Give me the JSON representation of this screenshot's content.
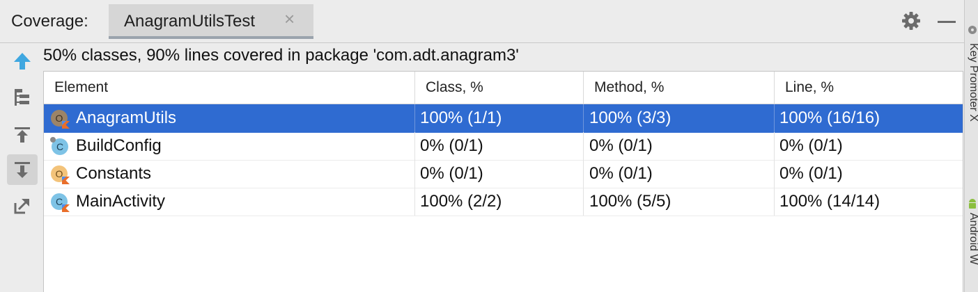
{
  "toolwindow": {
    "label": "Coverage:",
    "tab_title": "AnagramUtilsTest",
    "close_glyph": "×"
  },
  "toolbar_icons": [
    "up-arrow-icon",
    "flatten-packages-icon",
    "import-coverage-icon",
    "export-coverage-icon",
    "open-external-icon"
  ],
  "summary": "50% classes, 90% lines covered in package 'com.adt.anagram3'",
  "table": {
    "columns": [
      "Element",
      "Class, %",
      "Method, %",
      "Line, %"
    ],
    "rows": [
      {
        "name": "AnagramUtils",
        "class_pct": "100% (1/1)",
        "method_pct": "100% (3/3)",
        "line_pct": "100% (16/16)",
        "icon": "kotlin-object-icon",
        "selected": true
      },
      {
        "name": "BuildConfig",
        "class_pct": "0% (0/1)",
        "method_pct": "0% (0/1)",
        "line_pct": "0% (0/1)",
        "icon": "java-class-icon",
        "selected": false
      },
      {
        "name": "Constants",
        "class_pct": "0% (0/1)",
        "method_pct": "0% (0/1)",
        "line_pct": "0% (0/1)",
        "icon": "kotlin-object-icon",
        "selected": false
      },
      {
        "name": "MainActivity",
        "class_pct": "100% (2/2)",
        "method_pct": "100% (5/5)",
        "line_pct": "100% (14/14)",
        "icon": "kotlin-class-icon",
        "selected": false
      }
    ]
  },
  "right_strip": {
    "label_top": "Key Promoter X",
    "label_bottom": "Android W"
  },
  "colors": {
    "selection": "#2f6bd1",
    "accent_blue": "#3fa7e0",
    "kotlin_orange": "#e96e2a"
  }
}
